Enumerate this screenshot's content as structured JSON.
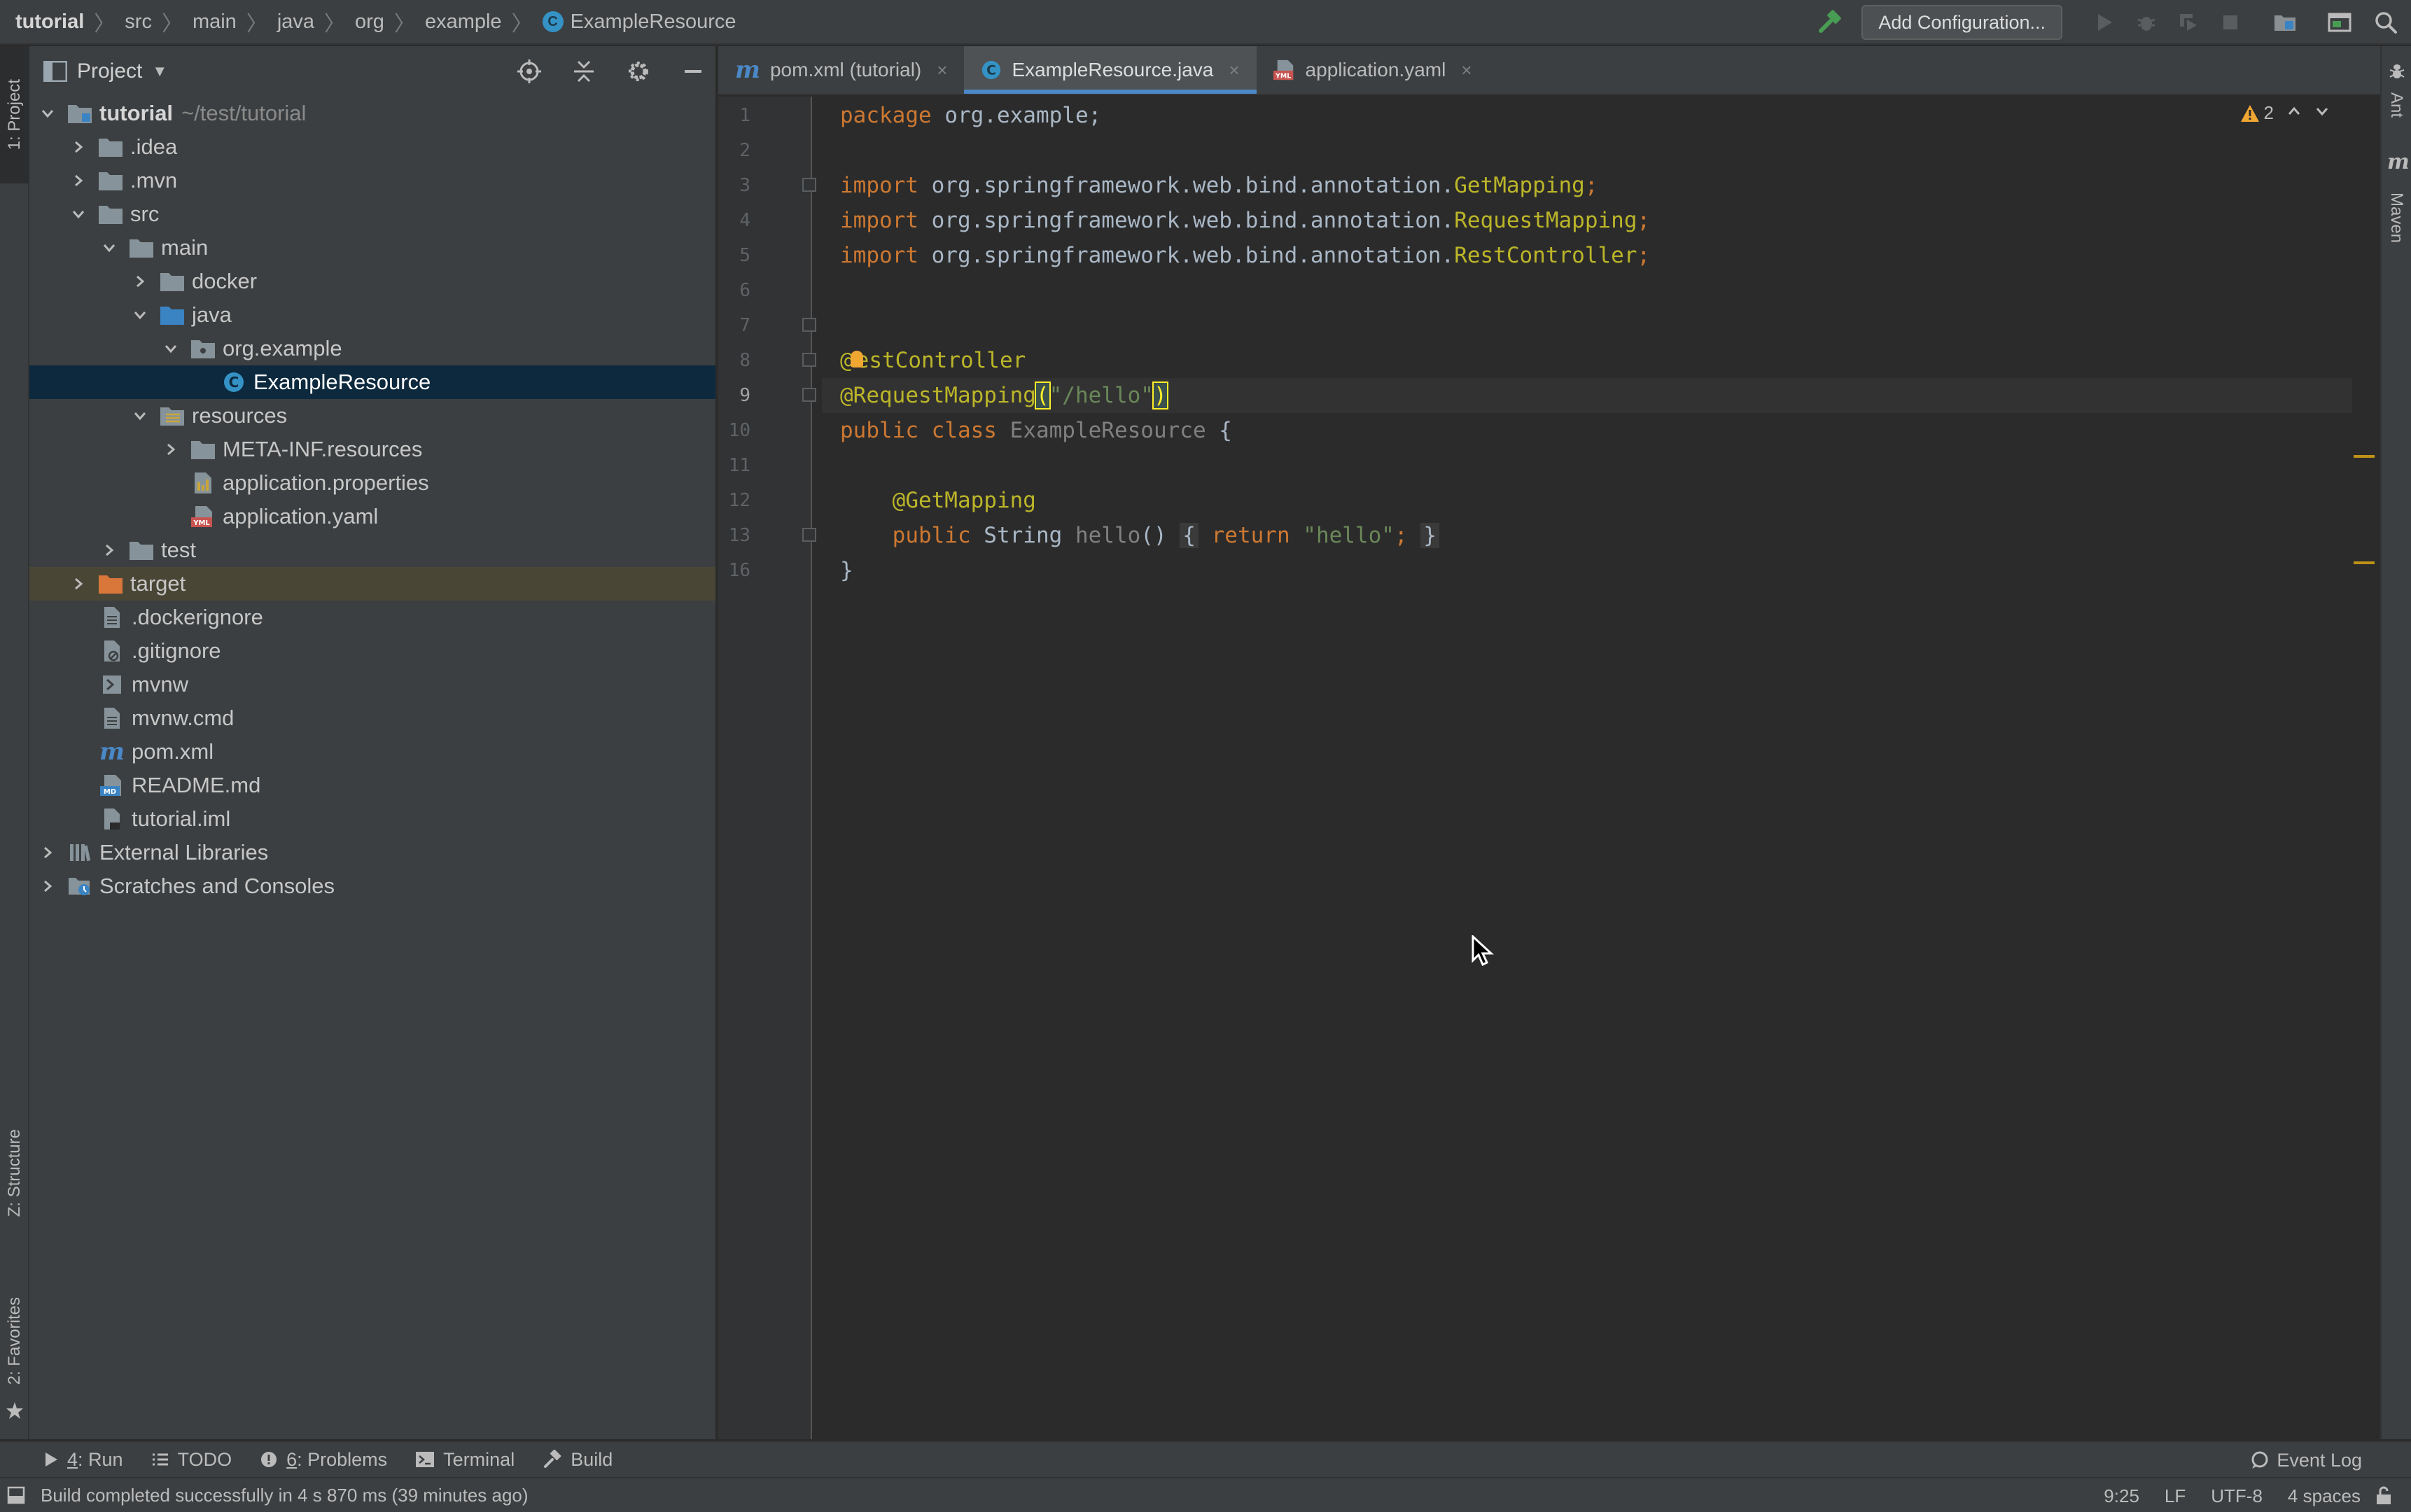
{
  "breadcrumbs": [
    "tutorial",
    "src",
    "main",
    "java",
    "org",
    "example",
    "ExampleResource"
  ],
  "navbar": {
    "add_configuration": "Add Configuration..."
  },
  "left_strip": {
    "project": "1: Project",
    "structure": "Z: Structure",
    "favorites": "2: Favorites"
  },
  "right_strip": {
    "ant": "Ant",
    "maven": "Maven"
  },
  "project_panel": {
    "title": "Project",
    "tree": [
      {
        "label": "tutorial",
        "hint": "~/test/tutorial"
      },
      {
        "label": ".idea"
      },
      {
        "label": ".mvn"
      },
      {
        "label": "src"
      },
      {
        "label": "main"
      },
      {
        "label": "docker"
      },
      {
        "label": "java"
      },
      {
        "label": "org.example"
      },
      {
        "label": "ExampleResource"
      },
      {
        "label": "resources"
      },
      {
        "label": "META-INF.resources"
      },
      {
        "label": "application.properties"
      },
      {
        "label": "application.yaml"
      },
      {
        "label": "test"
      },
      {
        "label": "target"
      },
      {
        "label": ".dockerignore"
      },
      {
        "label": ".gitignore"
      },
      {
        "label": "mvnw"
      },
      {
        "label": "mvnw.cmd"
      },
      {
        "label": "pom.xml"
      },
      {
        "label": "README.md"
      },
      {
        "label": "tutorial.iml"
      },
      {
        "label": "External Libraries"
      },
      {
        "label": "Scratches and Consoles"
      }
    ]
  },
  "tabs": [
    {
      "label": "pom.xml (tutorial)"
    },
    {
      "label": "ExampleResource.java"
    },
    {
      "label": "application.yaml"
    }
  ],
  "editor": {
    "line_numbers": [
      "1",
      "2",
      "3",
      "4",
      "5",
      "6",
      "7",
      "8",
      "9",
      "10",
      "11",
      "12",
      "13",
      "16"
    ],
    "warnings_count": "2",
    "code": {
      "l1_kw": "package",
      "l1_rest": " org.example;",
      "import_kw": "import",
      "l3_pkg": " org.springframework.web.bind.annotation.",
      "l3_cls": "GetMapping",
      "semi": ";",
      "l4_cls": "RequestMapping",
      "l5_cls": "RestController",
      "l8_at": "@",
      "l8_rest": "estController",
      "l9_ann": "@RequestMapping",
      "l9_paren": "(",
      "l9_str": "\"/hello\"",
      "l9_close": ")",
      "l10_public": "public",
      "l10_class": "class",
      "l10_name": "ExampleResource",
      "l10_brace": " {",
      "l12_ann": "@GetMapping",
      "l13_public": "public",
      "l13_type": " String ",
      "l13_fn": "hello",
      "l13_parens": "()",
      "l13_open": "{",
      "l13_return": "return",
      "l13_str": "\"hello\"",
      "l13_semi": ";",
      "l13_close": "}",
      "l16_brace": "}"
    }
  },
  "toolbar": {
    "run_num": "4",
    "run_label": ": Run",
    "todo": "TODO",
    "problems_num": "6",
    "problems_label": ": Problems",
    "terminal": "Terminal",
    "build": "Build",
    "event_log": "Event Log"
  },
  "status": {
    "message": "Build completed successfully in 4 s 870 ms (39 minutes ago)",
    "position": "9:25",
    "line_sep": "LF",
    "encoding": "UTF-8",
    "indent": "4 spaces"
  }
}
